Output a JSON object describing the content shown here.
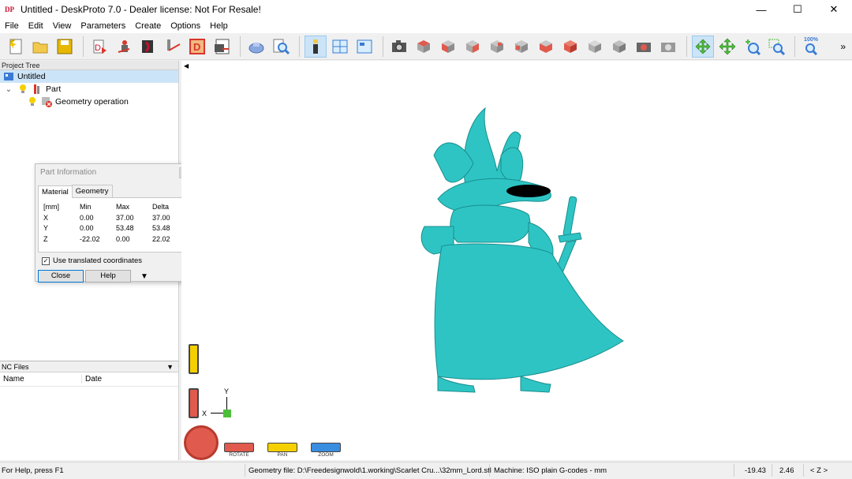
{
  "window": {
    "title": "Untitled - DeskProto 7.0 - Dealer license: Not For Resale!",
    "app_icon_text": "DP",
    "minimize": "—",
    "maximize": "☐",
    "close": "✕"
  },
  "menu": [
    "File",
    "Edit",
    "View",
    "Parameters",
    "Create",
    "Options",
    "Help"
  ],
  "toolbar": {
    "zoom_label": "100%",
    "more": "»",
    "colors": {
      "cube_red": "#e05a4e",
      "cube_grey": "#a8a8a8",
      "accent_green": "#4cbf3a",
      "active_bg": "#cce4f7"
    }
  },
  "project_tree": {
    "header": "Project Tree",
    "items": [
      {
        "label": "Untitled",
        "icon": "project-icon",
        "level": 0,
        "selected": true
      },
      {
        "label": "Part",
        "icon": "part-icon",
        "level": 1,
        "selected": false
      },
      {
        "label": "Geometry operation",
        "icon": "geometry-operation-icon",
        "level": 2,
        "selected": false
      }
    ]
  },
  "part_info": {
    "title": "Part Information",
    "tabs": [
      "Material",
      "Geometry"
    ],
    "active_tab": "Material",
    "columns": [
      "[mm]",
      "Min",
      "Max",
      "Delta"
    ],
    "rows": [
      [
        "X",
        "0.00",
        "37.00",
        "37.00"
      ],
      [
        "Y",
        "0.00",
        "53.48",
        "53.48"
      ],
      [
        "Z",
        "-22.02",
        "0.00",
        "22.02"
      ]
    ],
    "checkbox_label": "Use translated coordinates",
    "checkbox_checked": true,
    "close_button": "Close",
    "help_button": "Help"
  },
  "nc_files": {
    "header": "NC Files",
    "columns": [
      "Name",
      "Date"
    ]
  },
  "viewport": {
    "model_color": "#2ec4c4",
    "axis_y": "Y",
    "axis_x": "X",
    "nav_buttons": [
      "ROTATE",
      "PAN",
      "ZOOM"
    ]
  },
  "statusbar": {
    "help": "For Help, press F1",
    "geometry_file": "Geometry file: D:\\Freedesignwold\\1.working\\Scarlet Cru...\\32mm_Lord.stl",
    "machine": "Machine: ISO plain G-codes - mm",
    "x_value": "-19.43",
    "y_value": "2.46",
    "z_label": "< Z >"
  }
}
